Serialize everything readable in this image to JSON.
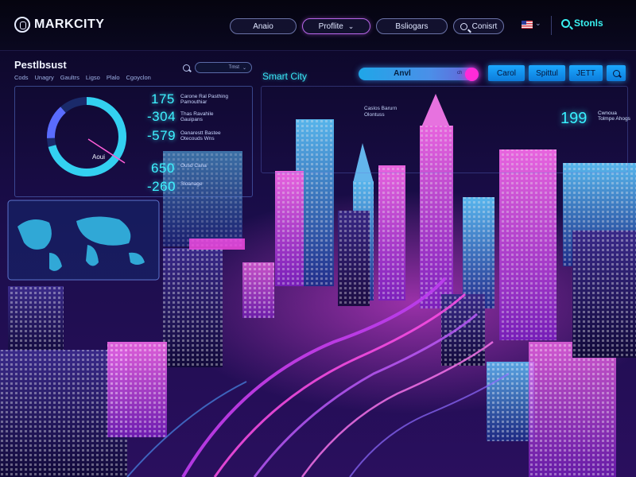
{
  "app": {
    "logo_text": "MARKCITY",
    "logo_icon": "camera-icon"
  },
  "top_nav": {
    "items": [
      {
        "label": "Anaio"
      },
      {
        "label": "Proflite"
      },
      {
        "label": "Bsliogars"
      },
      {
        "label": "Conisrt"
      }
    ],
    "language_flag": "us-flag-icon",
    "search_label": "Stonls"
  },
  "left_panel": {
    "title": "Pestlbsust",
    "tabs": [
      "Cods",
      "Unagry",
      "Gaultrs",
      "Ligso",
      "Plalo",
      "Cgoyclon"
    ],
    "select_value": "Tmst",
    "gauge_label": "Aoui",
    "stats": [
      {
        "value": "175",
        "desc": "Carone Ral Pasthing Pamouthiar"
      },
      {
        "value": "-304",
        "desc": "Thas Ravahile Gauipans"
      },
      {
        "value": "-579",
        "desc": "Oanarestt Bastee Otecouds Wns"
      },
      {
        "value": "650",
        "desc": "Ousd Cana"
      },
      {
        "value": "-260",
        "desc": "Sloanage"
      }
    ]
  },
  "center": {
    "title": "Smart City",
    "slider_label": "Anvl",
    "slider_tag": "ch",
    "slider_level": 1.0,
    "note": "Caslos Barurn Olontuss",
    "buttons": [
      {
        "label": "Carol"
      },
      {
        "label": "Spittul"
      },
      {
        "label": "JETT"
      }
    ],
    "right_stat": {
      "value": "199",
      "desc": "Cwnoua Tolmpe Ahogs"
    }
  },
  "colors": {
    "accent_cyan": "#38f0ff",
    "accent_magenta": "#ff2bd8",
    "button_blue": "#1ba8ff",
    "background": "#07051a"
  }
}
